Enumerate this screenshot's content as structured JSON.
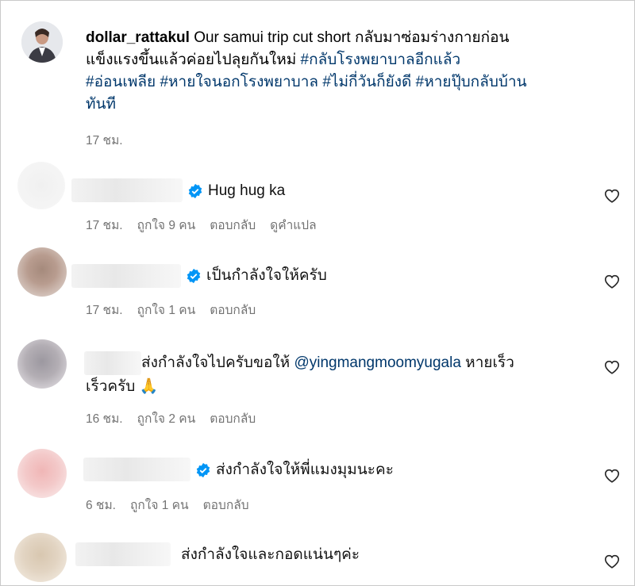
{
  "post": {
    "username": "dollar_rattakul",
    "caption_text": " Our samui trip cut short กลับมาซ่อมร่างกายก่อน",
    "caption_line2": "แข็งแรงขึ้นแล้วค่อยไปลุยกันใหม่ ",
    "hashtags": [
      "#กลับโรงพยาบาลอีกแล้ว",
      "#อ่อนเพลีย",
      "#หายใจนอกโรงพยาบาล",
      "#ไม่กี่วันก็ยังดี",
      "#หายปุ๊บกลับบ้าน",
      "ทันที"
    ],
    "time": "17 ชม."
  },
  "comments": [
    {
      "text": "Hug hug ka",
      "time": "17 ชม.",
      "likes": "ถูกใจ 9 คน",
      "reply": "ตอบกลับ",
      "translate": "ดูคำแปล",
      "verified": true
    },
    {
      "text": "เป็นกำลังใจให้ครับ",
      "time": "17 ชม.",
      "likes": "ถูกใจ 1 คน",
      "reply": "ตอบกลับ",
      "verified": true
    },
    {
      "text_line1_a": "ส่งกำลังใจไปครับขอให้ ",
      "mention": "@yingmangmoomyugala",
      "text_line1_b": " หายเร็ว",
      "text_line2": "เร็วครับ",
      "emoji": "🙏",
      "time": "16 ชม.",
      "likes": "ถูกใจ 2 คน",
      "reply": "ตอบกลับ",
      "verified": false
    },
    {
      "text": "ส่งกำลังใจให้พี่แมงมุมนะคะ",
      "time": "6 ชม.",
      "likes": "ถูกใจ 1 คน",
      "reply": "ตอบกลับ",
      "verified": true
    },
    {
      "text": "ส่งกำลังใจและกอดแน่นๆค่ะ",
      "verified": false
    }
  ],
  "colors": {
    "link": "#00376b",
    "meta": "#737373",
    "verified": "#0095f6"
  }
}
